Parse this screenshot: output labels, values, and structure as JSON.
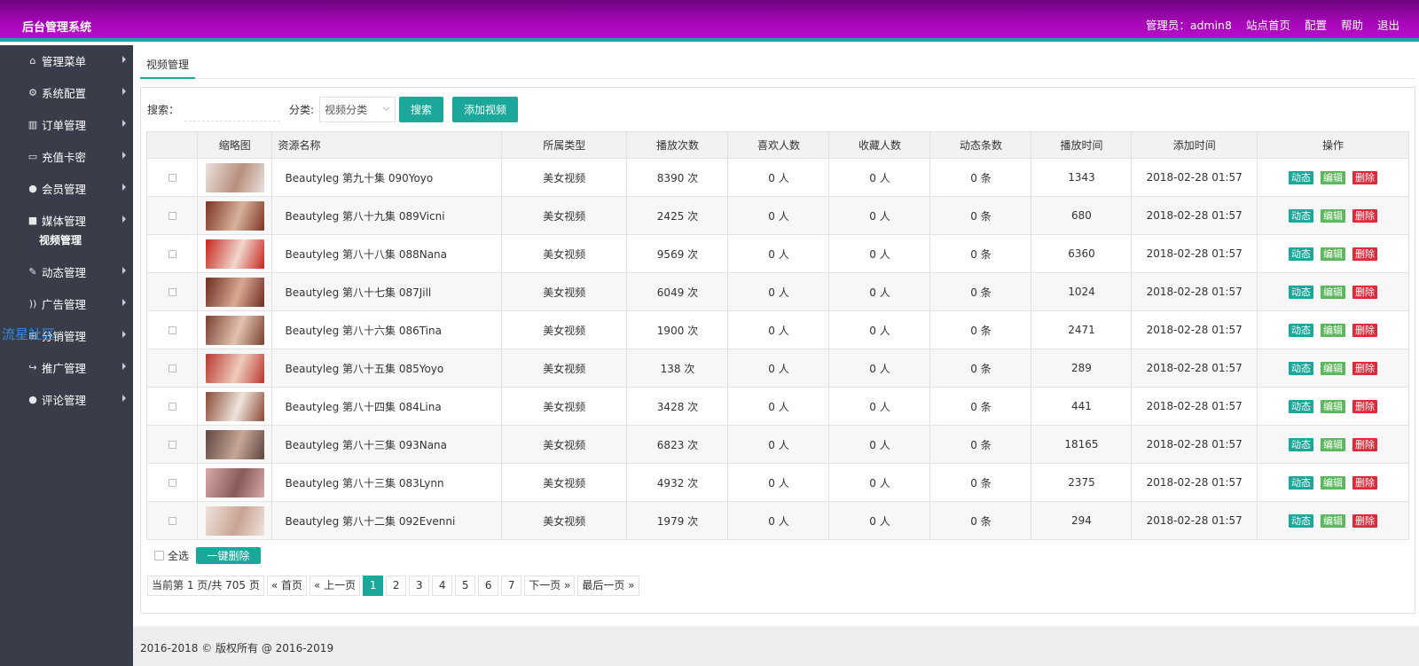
{
  "header": {
    "title": "后台管理系统",
    "nav": [
      "管理员：admin8",
      "站点首页",
      "配置",
      "帮助",
      "退出"
    ],
    "gradient_colors": [
      "#6f047f",
      "#b80ccc"
    ],
    "accent": "#1ba89a"
  },
  "sidebar": {
    "items": [
      {
        "label": "管理菜单",
        "icon": "home-icon",
        "glyph": "⌂"
      },
      {
        "label": "系统配置",
        "icon": "gears-icon",
        "glyph": "⚙"
      },
      {
        "label": "订单管理",
        "icon": "bar-chart-icon",
        "glyph": "▥"
      },
      {
        "label": "充值卡密",
        "icon": "credit-card-icon",
        "glyph": "▭"
      },
      {
        "label": "会员管理",
        "icon": "user-icon",
        "glyph": "●"
      },
      {
        "label": "媒体管理",
        "icon": "video-camera-icon",
        "glyph": "■"
      },
      {
        "label": "动态管理",
        "icon": "pencil-icon",
        "glyph": "✎"
      },
      {
        "label": "广告管理",
        "icon": "rss-icon",
        "glyph": "))"
      },
      {
        "label": "分销管理",
        "icon": "sitemap-icon",
        "glyph": "⊞"
      },
      {
        "label": "推广管理",
        "icon": "share-icon",
        "glyph": "↪"
      },
      {
        "label": "评论管理",
        "icon": "comment-icon",
        "glyph": "●"
      }
    ],
    "submenu_under_index": 5,
    "submenu_label": "视频管理",
    "watermark": "流星社区",
    "bg_color": "#393d49"
  },
  "main": {
    "tab": "视频管理",
    "search_label": "搜索：",
    "search_value": "",
    "category_label": "分类:",
    "category_selected": "视频分类",
    "search_button": "搜索",
    "add_button": "添加视频",
    "columns": [
      "",
      "缩略图",
      "资源名称",
      "所属类型",
      "播放次数",
      "喜欢人数",
      "收藏人数",
      "动态条数",
      "播放时间",
      "添加时间",
      "操作"
    ],
    "rows": [
      {
        "name": "Beautyleg 第九十集 090Yoyo",
        "type": "美女视频",
        "plays": "8390 次",
        "likes": "0 人",
        "favs": "0 人",
        "dyn": "0 条",
        "duration": "1343",
        "added": "2018-02-28 01:57",
        "thumb_colors": [
          "#e9e2de",
          "#b98f7d"
        ]
      },
      {
        "name": "Beautyleg 第八十九集 089Vicni",
        "type": "美女视频",
        "plays": "2425 次",
        "likes": "0 人",
        "favs": "0 人",
        "dyn": "0 条",
        "duration": "680",
        "added": "2018-02-28 01:57",
        "thumb_colors": [
          "#7d3426",
          "#d7b29a"
        ]
      },
      {
        "name": "Beautyleg 第八十八集 088Nana",
        "type": "美女视频",
        "plays": "9569 次",
        "likes": "0 人",
        "favs": "0 人",
        "dyn": "0 条",
        "duration": "6360",
        "added": "2018-02-28 01:57",
        "thumb_colors": [
          "#c8261e",
          "#f1d6cc"
        ]
      },
      {
        "name": "Beautyleg 第八十七集 087Jill",
        "type": "美女视频",
        "plays": "6049 次",
        "likes": "0 人",
        "favs": "0 人",
        "dyn": "0 条",
        "duration": "1024",
        "added": "2018-02-28 01:57",
        "thumb_colors": [
          "#6e2d22",
          "#d9a892"
        ]
      },
      {
        "name": "Beautyleg 第八十六集 086Tina",
        "type": "美女视频",
        "plays": "1900 次",
        "likes": "0 人",
        "favs": "0 人",
        "dyn": "0 条",
        "duration": "2471",
        "added": "2018-02-28 01:57",
        "thumb_colors": [
          "#7a4232",
          "#e3c2b0"
        ]
      },
      {
        "name": "Beautyleg 第八十五集 085Yoyo",
        "type": "美女视频",
        "plays": "138 次",
        "likes": "0 人",
        "favs": "0 人",
        "dyn": "0 条",
        "duration": "289",
        "added": "2018-02-28 01:57",
        "thumb_colors": [
          "#b8392e",
          "#efcbbc"
        ]
      },
      {
        "name": "Beautyleg 第八十四集 084Lina",
        "type": "美女视频",
        "plays": "3428 次",
        "likes": "0 人",
        "favs": "0 人",
        "dyn": "0 条",
        "duration": "441",
        "added": "2018-02-28 01:57",
        "thumb_colors": [
          "#8a4a34",
          "#efe4dc"
        ]
      },
      {
        "name": "Beautyleg 第八十三集 093Nana",
        "type": "美女视频",
        "plays": "6823 次",
        "likes": "0 人",
        "favs": "0 人",
        "dyn": "0 条",
        "duration": "18165",
        "added": "2018-02-28 01:57",
        "thumb_colors": [
          "#5e4640",
          "#c7a696"
        ]
      },
      {
        "name": "Beautyleg 第八十三集 083Lynn",
        "type": "美女视频",
        "plays": "4932 次",
        "likes": "0 人",
        "favs": "0 人",
        "dyn": "0 条",
        "duration": "2375",
        "added": "2018-02-28 01:57",
        "thumb_colors": [
          "#d9a9a6",
          "#8a5a5a"
        ]
      },
      {
        "name": "Beautyleg 第八十二集 092Evenni",
        "type": "美女视频",
        "plays": "1979 次",
        "likes": "0 人",
        "favs": "0 人",
        "dyn": "0 条",
        "duration": "294",
        "added": "2018-02-28 01:57",
        "thumb_colors": [
          "#efe3dc",
          "#c9a493"
        ]
      }
    ],
    "row_actions": [
      "动态",
      "编辑",
      "删除"
    ],
    "action_colors": {
      "dynamic": "#1ba89a",
      "edit": "#5cb85c",
      "delete": "#e02a3a"
    },
    "select_all_label": "全选",
    "bulk_delete_button": "一键删除",
    "pagination": {
      "info": "当前第 1 页/共 705 页",
      "first": "« 首页",
      "prev": "« 上一页",
      "pages": [
        "1",
        "2",
        "3",
        "4",
        "5",
        "6",
        "7"
      ],
      "current": "1",
      "next": "下一页 »",
      "last": "最后一页 »"
    }
  },
  "footer": {
    "text": "2016-2018 © 版权所有 @ 2016-2019"
  }
}
